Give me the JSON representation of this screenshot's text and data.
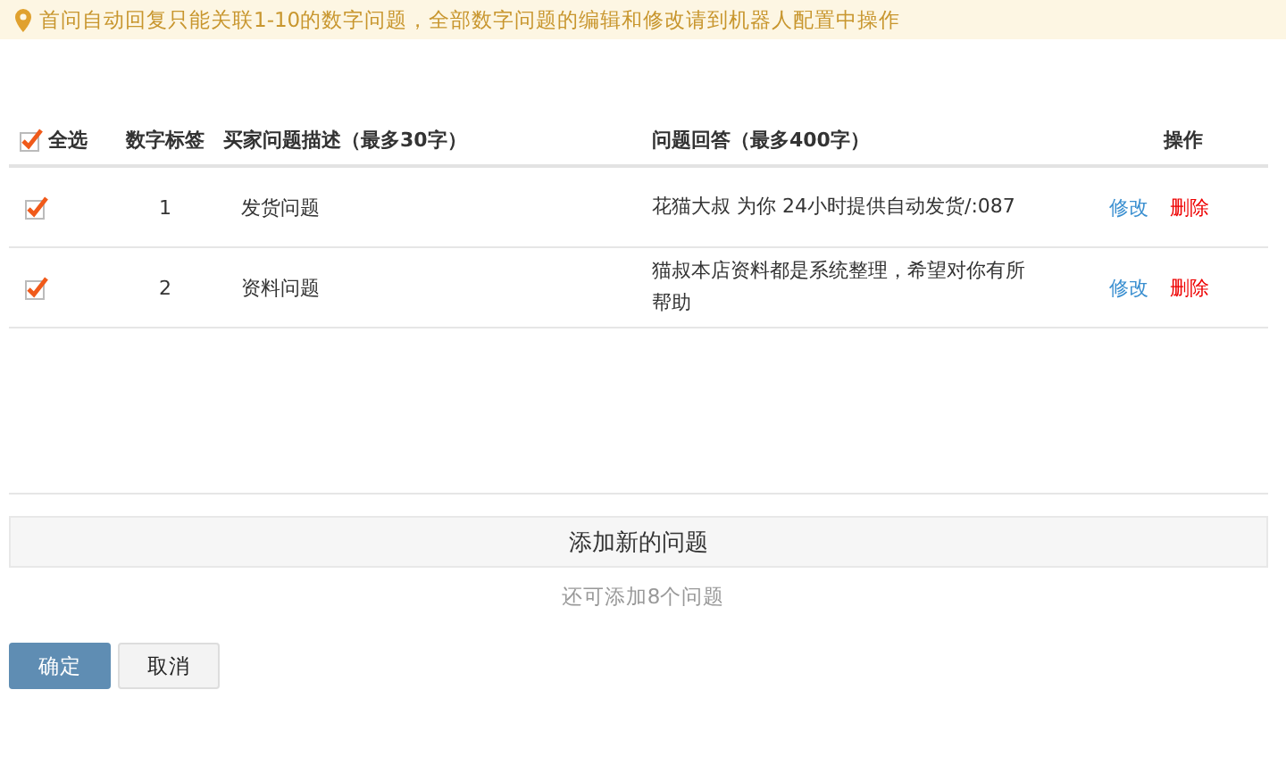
{
  "notice": {
    "text": "首问自动回复只能关联1-10的数字问题，全部数字问题的编辑和修改请到机器人配置中操作"
  },
  "table": {
    "select_all": {
      "label": "全选",
      "checked": true
    },
    "columns": [
      "数字标签",
      "买家问题描述（最多30字）",
      "问题回答（最多400字）",
      "操作"
    ],
    "rows": [
      {
        "checked": true,
        "number": "1",
        "question": "发货问题",
        "answer": "花猫大叔 为你 24小时提供自动发货/:087",
        "edit": "修改",
        "delete": "删除"
      },
      {
        "checked": true,
        "number": "2",
        "question": "资料问题",
        "answer": "猫叔本店资料都是系统整理，希望对你有所帮助",
        "edit": "修改",
        "delete": "删除"
      }
    ]
  },
  "add_button": "添加新的问题",
  "remaining": "还可添加8个问题",
  "buttons": [
    {
      "label": "确定",
      "kind": "primary"
    },
    {
      "label": "取消",
      "kind": "secondary"
    }
  ]
}
